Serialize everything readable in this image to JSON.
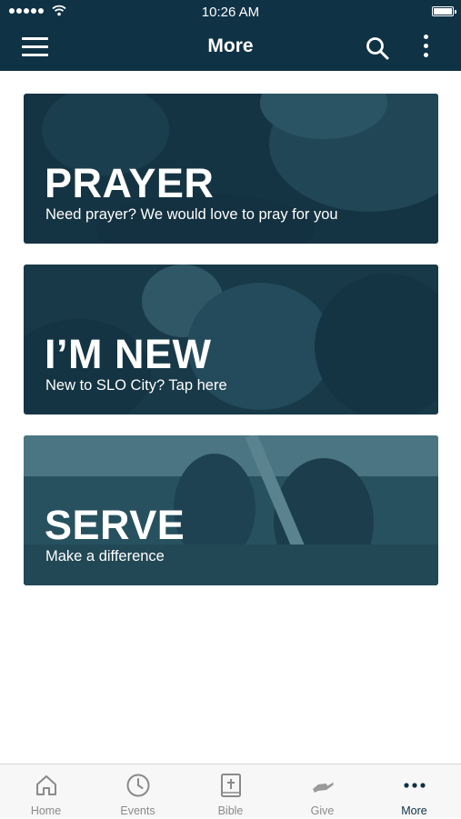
{
  "status_bar": {
    "time": "10:26 AM"
  },
  "header": {
    "title": "More"
  },
  "cards": [
    {
      "heading": "PRAYER",
      "subtitle": "Need prayer? We would love to pray for you"
    },
    {
      "heading": "I’M NEW",
      "subtitle": "New to SLO City? Tap here"
    },
    {
      "heading": "SERVE",
      "subtitle": "Make a difference"
    }
  ],
  "tabbar": {
    "items": [
      {
        "label": "Home",
        "icon": "home-icon"
      },
      {
        "label": "Events",
        "icon": "clock-icon"
      },
      {
        "label": "Bible",
        "icon": "bible-icon"
      },
      {
        "label": "Give",
        "icon": "give-hand-icon"
      },
      {
        "label": "More",
        "icon": "more-dots-icon"
      }
    ],
    "active": "More"
  },
  "colors": {
    "header_bg": "#0f3245",
    "card_tint": "#1f4b5c",
    "tab_inactive": "#8a8a8a",
    "tab_active": "#0f3245"
  }
}
